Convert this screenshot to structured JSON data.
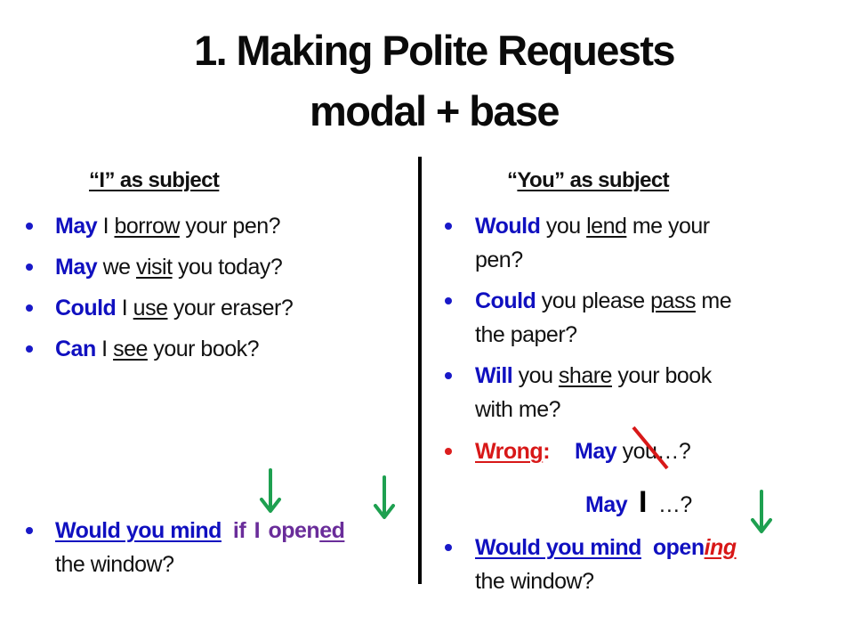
{
  "title": {
    "line1": "1.  Making Polite Requests",
    "line2": "modal + base"
  },
  "left": {
    "heading_q_open": "“I” as subject",
    "items": [
      {
        "modal": "May",
        "pre": " I ",
        "verb": "borrow",
        "post": " your pen?"
      },
      {
        "modal": "May",
        "pre": " we ",
        "verb": "visit",
        "post": " you today?"
      },
      {
        "modal": "Could",
        "pre": " I ",
        "verb": "use",
        "post": " your eraser?"
      },
      {
        "modal": "Can",
        "pre": " I ",
        "verb": "see",
        "post": " your book?"
      }
    ],
    "mind": {
      "phrase": "Would you mind",
      "if_part": "if  I  open",
      "ending": "ed",
      "line2": "the window?"
    }
  },
  "right": {
    "heading_open": "“",
    "heading_rest": "You” as subject",
    "items": [
      {
        "modal": "Would",
        "pre": " you ",
        "verb": "lend",
        "post": " me your",
        "line2": "pen?"
      },
      {
        "modal": "Could",
        "pre": " you please ",
        "verb": "pass",
        "post": " me",
        "line2": "the paper?"
      },
      {
        "modal": "Will",
        "pre": " you ",
        "verb": "share",
        "post": " your book",
        "line2": "with me?"
      }
    ],
    "wrong": {
      "label": "Wrong",
      "colon": ":",
      "modal": "May",
      "rest": " you…?"
    },
    "correct": {
      "modal": "May",
      "subject": "I",
      "rest": "…?"
    },
    "mind": {
      "phrase": "Would you mind",
      "verb": "open",
      "ending": "ing",
      "line2": "the window?"
    }
  },
  "colors": {
    "modal_blue": "#1010c0",
    "purple": "#6a2d9a",
    "wrong_red": "#d81818",
    "arrow_green": "#1ea050"
  },
  "icons": {
    "arrows": [
      "green-down-arrow",
      "green-down-arrow",
      "green-down-arrow"
    ],
    "strike": "red-strike-line"
  }
}
